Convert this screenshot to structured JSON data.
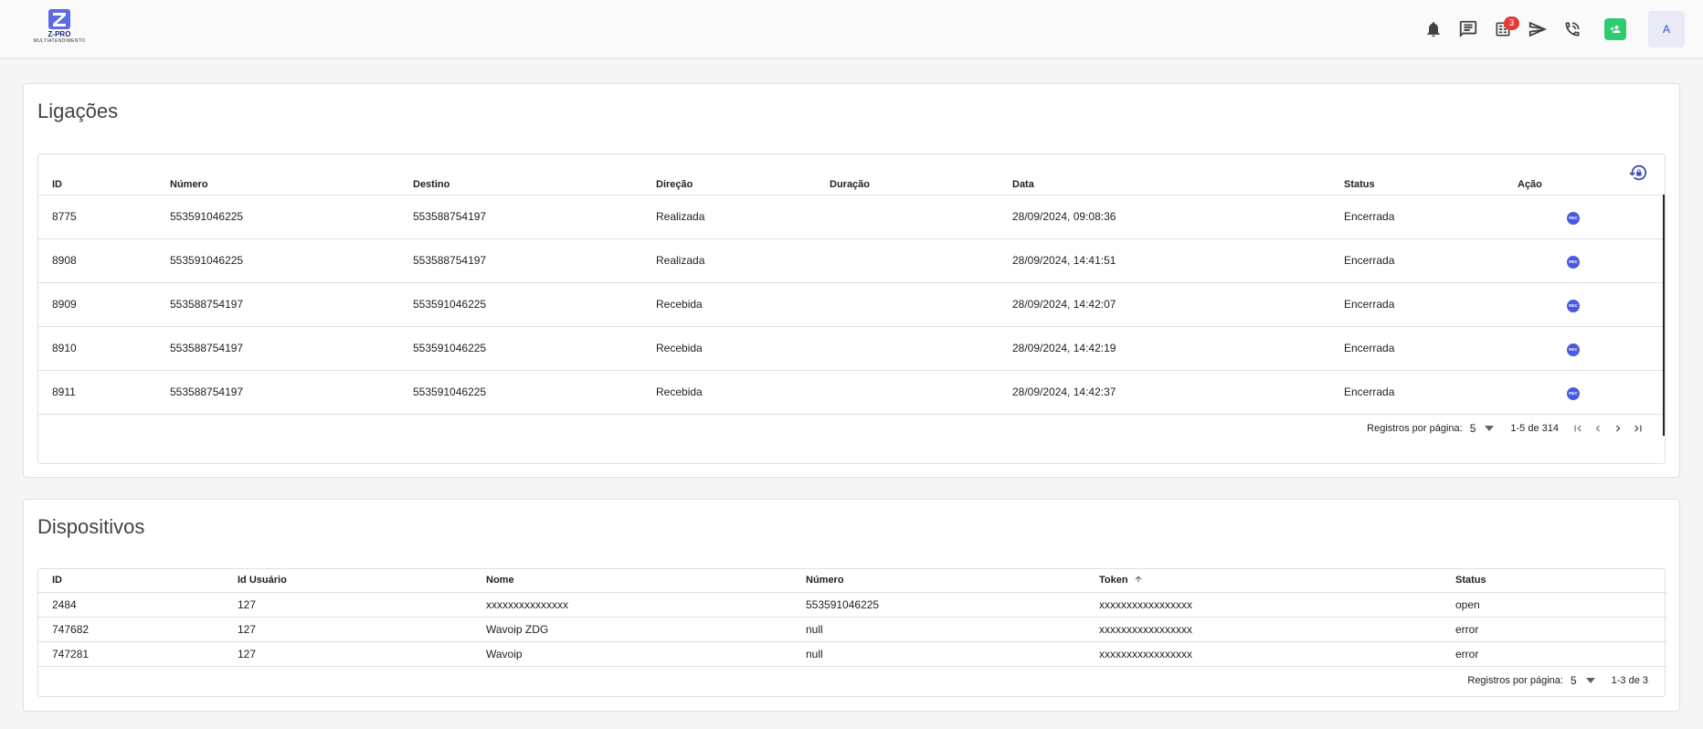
{
  "header": {
    "logo_text": "Z-PRO",
    "logo_sub": "MULTIATENDIMENTO",
    "badge_count": "3",
    "avatar_initial": "A"
  },
  "calls": {
    "title": "Ligações",
    "columns": [
      "ID",
      "Número",
      "Destino",
      "Direção",
      "Duração",
      "Data",
      "Status",
      "Ação"
    ],
    "rows": [
      {
        "id": "8775",
        "numero": "553591046225",
        "destino": "553588754197",
        "direcao": "Realizada",
        "duracao": "",
        "data": "28/09/2024, 09:08:36",
        "status": "Encerrada",
        "acao": "REC"
      },
      {
        "id": "8908",
        "numero": "553591046225",
        "destino": "553588754197",
        "direcao": "Realizada",
        "duracao": "",
        "data": "28/09/2024, 14:41:51",
        "status": "Encerrada",
        "acao": "REC"
      },
      {
        "id": "8909",
        "numero": "553588754197",
        "destino": "553591046225",
        "direcao": "Recebida",
        "duracao": "",
        "data": "28/09/2024, 14:42:07",
        "status": "Encerrada",
        "acao": "REC"
      },
      {
        "id": "8910",
        "numero": "553588754197",
        "destino": "553591046225",
        "direcao": "Recebida",
        "duracao": "",
        "data": "28/09/2024, 14:42:19",
        "status": "Encerrada",
        "acao": "REC"
      },
      {
        "id": "8911",
        "numero": "553588754197",
        "destino": "553591046225",
        "direcao": "Recebida",
        "duracao": "",
        "data": "28/09/2024, 14:42:37",
        "status": "Encerrada",
        "acao": "REC"
      }
    ],
    "pager": {
      "label": "Registros por página:",
      "per_page": "5",
      "range": "1-5 de 314"
    }
  },
  "devices": {
    "title": "Dispositivos",
    "columns": [
      "ID",
      "Id Usuário",
      "Nome",
      "Número",
      "Token",
      "Status"
    ],
    "rows": [
      {
        "id": "2484",
        "user": "127",
        "nome": "xxxxxxxxxxxxxxx",
        "numero": "553591046225",
        "token": "xxxxxxxxxxxxxxxxx",
        "status": "open"
      },
      {
        "id": "747682",
        "user": "127",
        "nome": "Wavoip ZDG",
        "numero": "null",
        "token": "xxxxxxxxxxxxxxxxx",
        "status": "error"
      },
      {
        "id": "747281",
        "user": "127",
        "nome": "Wavoip",
        "numero": "null",
        "token": "xxxxxxxxxxxxxxxxx",
        "status": "error"
      }
    ],
    "pager": {
      "label": "Registros por página:",
      "per_page": "5",
      "range": "1-3 de 3"
    }
  },
  "colors": {
    "accent": "#3f51b5",
    "green": "#2ecc71",
    "badge": "#e53935"
  },
  "icons": [
    "bell-icon",
    "chat-icon",
    "tasks-icon",
    "send-icon",
    "phone-icon",
    "add-contact-icon",
    "lock-reset-icon",
    "sort-asc-icon"
  ]
}
